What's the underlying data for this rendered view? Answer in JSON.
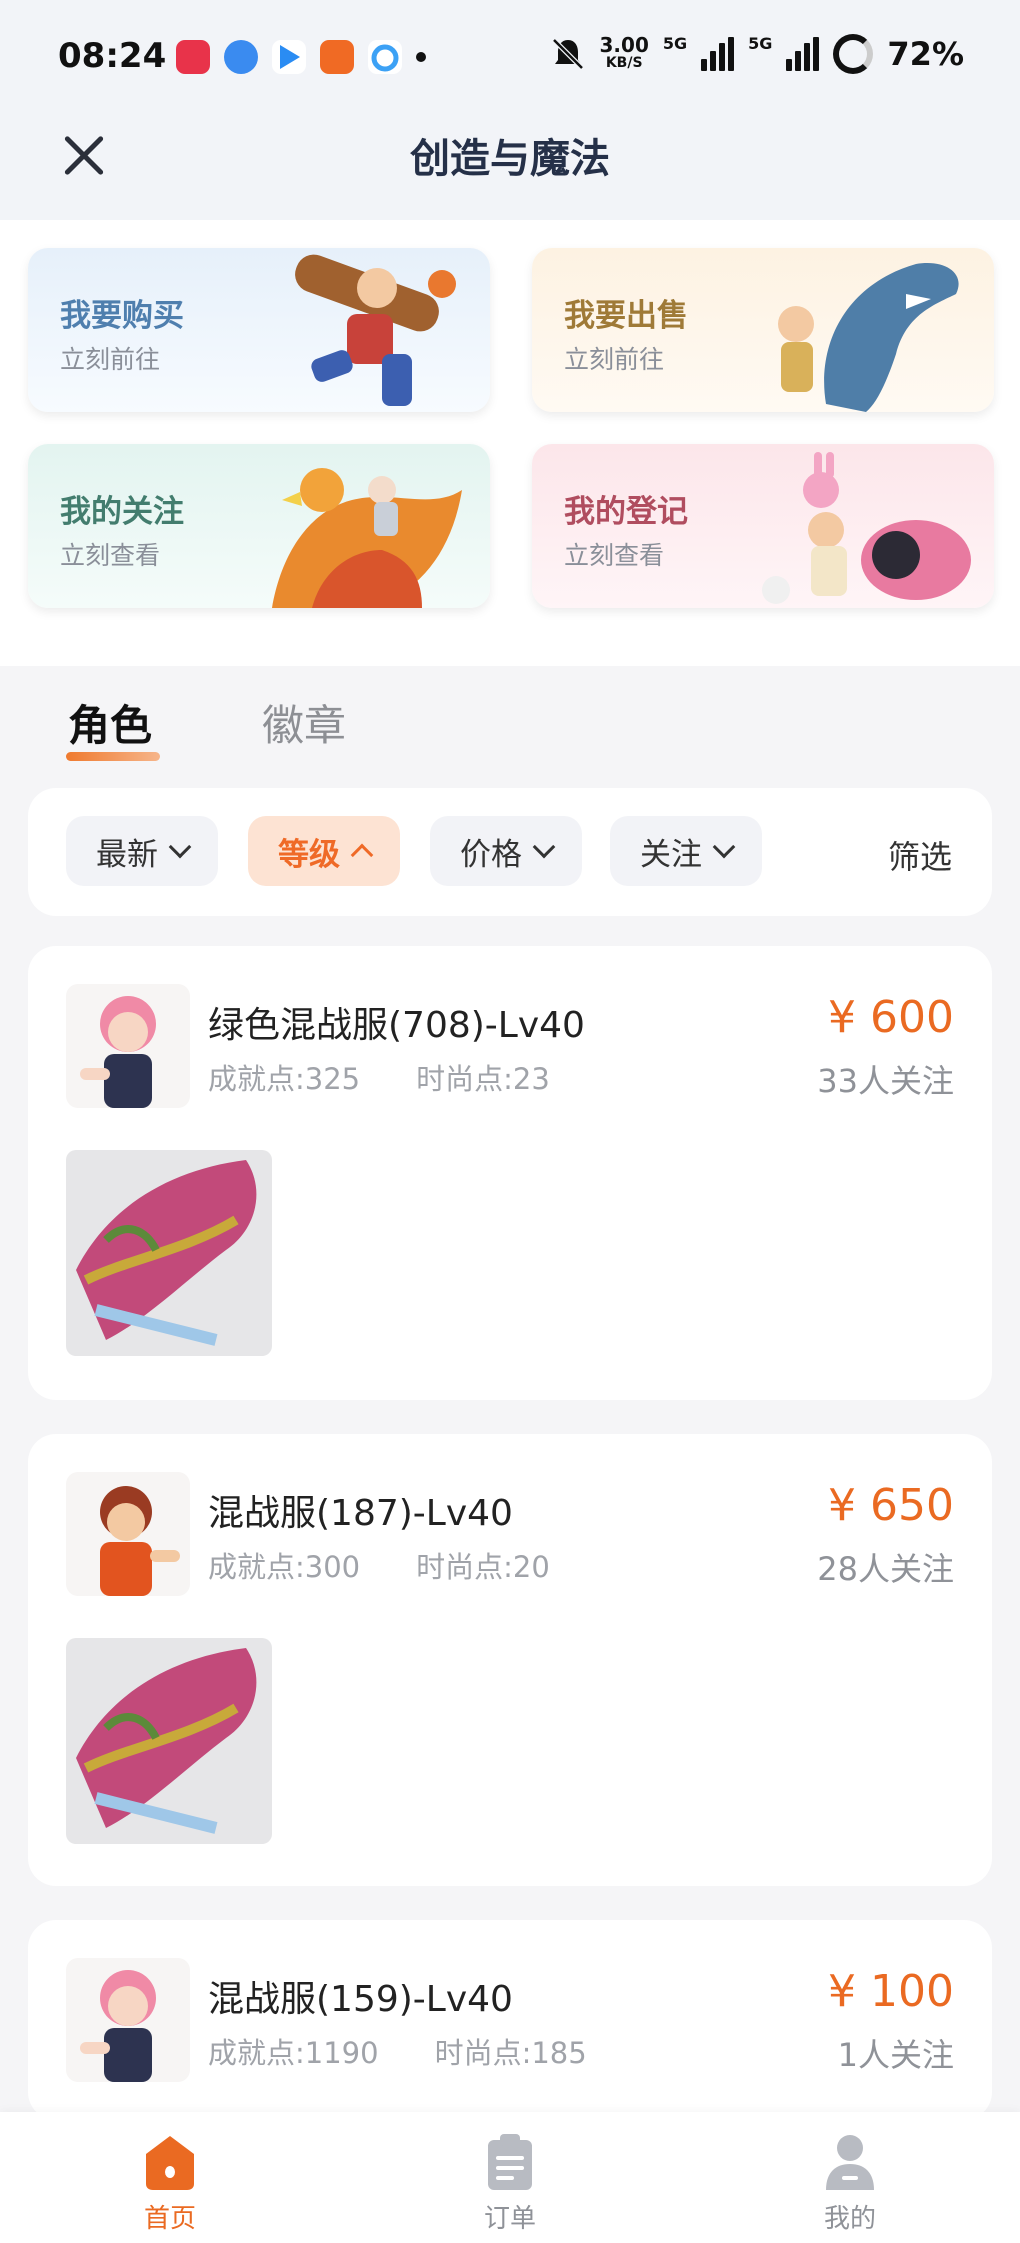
{
  "status_bar": {
    "time": "08:24",
    "net_speed_value": "3.00",
    "net_speed_unit": "KB/S",
    "net_label_1": "5G",
    "net_label_2": "5G",
    "battery": "72%"
  },
  "header": {
    "title": "创造与魔法"
  },
  "shortcuts": {
    "buy": {
      "title": "我要购买",
      "sub": "立刻前往"
    },
    "sell": {
      "title": "我要出售",
      "sub": "立刻前往"
    },
    "follow": {
      "title": "我的关注",
      "sub": "立刻查看"
    },
    "register": {
      "title": "我的登记",
      "sub": "立刻查看"
    }
  },
  "tabs": {
    "role": "角色",
    "badge": "徽章"
  },
  "filters": {
    "newest": "最新",
    "level": "等级",
    "price": "价格",
    "follow": "关注",
    "filter": "筛选"
  },
  "listings": [
    {
      "name": "绿色混战服(708)-Lv40",
      "achievement": "成就点:325",
      "fashion": "时尚点:23",
      "price": "¥ 600",
      "followers": "33人关注"
    },
    {
      "name": "混战服(187)-Lv40",
      "achievement": "成就点:300",
      "fashion": "时尚点:20",
      "price": "¥ 650",
      "followers": "28人关注"
    },
    {
      "name": "混战服(159)-Lv40",
      "achievement": "成就点:1190",
      "fashion": "时尚点:185",
      "price": "¥ 100",
      "followers": "1人关注"
    }
  ],
  "bottom_nav": {
    "home": "首页",
    "orders": "订单",
    "mine": "我的"
  },
  "colors": {
    "accent": "#ea6a22",
    "active_chip_bg": "#fde3d3"
  }
}
